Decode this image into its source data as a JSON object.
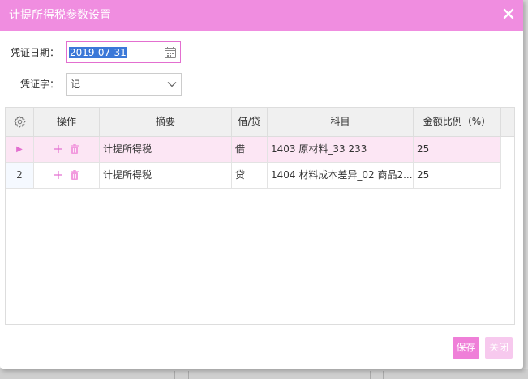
{
  "dialog": {
    "title": "计提所得税参数设置"
  },
  "form": {
    "date_label": "凭证日期：",
    "date_value": "2019-07-31",
    "voucher_label": "凭证字：",
    "voucher_value": "记"
  },
  "grid": {
    "columns": [
      "操作",
      "摘要",
      "借/贷",
      "科目",
      "金额比例（%）"
    ],
    "rows": [
      {
        "num": "▶",
        "summary": "计提所得税",
        "dc": "借",
        "account": "1403 原材料_33 233",
        "ratio": "25",
        "selected": true
      },
      {
        "num": "2",
        "summary": "计提所得税",
        "dc": "贷",
        "account": "1404 材料成本差异_02 商品2...",
        "ratio": "25",
        "selected": false
      }
    ]
  },
  "buttons": {
    "save": "保存",
    "close": "关闭"
  },
  "icons": {
    "settings": "gear-icon",
    "add": "plus-icon",
    "delete": "trash-icon",
    "calendar": "calendar-icon",
    "close": "close-icon"
  },
  "colors": {
    "accent": "#f08de0",
    "selected_row": "#fce6f4"
  }
}
